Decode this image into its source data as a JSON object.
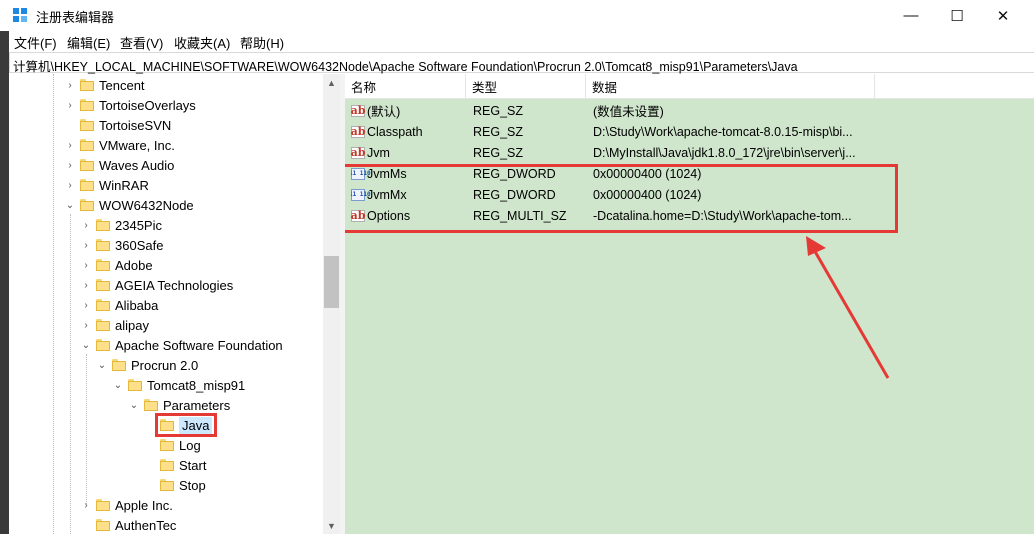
{
  "window": {
    "title": "注册表编辑器",
    "minimize": "—",
    "maximize": "☐",
    "close": "✕"
  },
  "menu": [
    "文件(F)",
    "编辑(E)",
    "查看(V)",
    "收藏夹(A)",
    "帮助(H)"
  ],
  "address": "计算机\\HKEY_LOCAL_MACHINE\\SOFTWARE\\WOW6432Node\\Apache Software Foundation\\Procrun 2.0\\Tomcat8_misp91\\Parameters\\Java",
  "tree": [
    {
      "label": "Tencent",
      "expander": "›"
    },
    {
      "label": "TortoiseOverlays",
      "expander": "›"
    },
    {
      "label": "TortoiseSVN",
      "expander": ""
    },
    {
      "label": "VMware, Inc.",
      "expander": "›"
    },
    {
      "label": "Waves Audio",
      "expander": "›"
    },
    {
      "label": "WinRAR",
      "expander": "›"
    },
    {
      "label": "WOW6432Node",
      "expander": "⌄"
    },
    {
      "label": "2345Pic",
      "expander": "›"
    },
    {
      "label": "360Safe",
      "expander": "›"
    },
    {
      "label": "Adobe",
      "expander": "›"
    },
    {
      "label": "AGEIA Technologies",
      "expander": "›"
    },
    {
      "label": "Alibaba",
      "expander": "›"
    },
    {
      "label": "alipay",
      "expander": "›"
    },
    {
      "label": "Apache Software Foundation",
      "expander": "⌄"
    },
    {
      "label": "Procrun 2.0",
      "expander": "⌄"
    },
    {
      "label": "Tomcat8_misp91",
      "expander": "⌄"
    },
    {
      "label": "Parameters",
      "expander": "⌄"
    },
    {
      "label": "Java",
      "expander": ""
    },
    {
      "label": "Log",
      "expander": ""
    },
    {
      "label": "Start",
      "expander": ""
    },
    {
      "label": "Stop",
      "expander": ""
    },
    {
      "label": "Apple Inc.",
      "expander": "›"
    },
    {
      "label": "AuthenTec",
      "expander": ""
    }
  ],
  "columns": [
    "名称",
    "类型",
    "数据"
  ],
  "values": [
    {
      "icon": "ab",
      "name": "(默认)",
      "type": "REG_SZ",
      "data": "(数值未设置)"
    },
    {
      "icon": "ab",
      "name": "Classpath",
      "type": "REG_SZ",
      "data": "D:\\Study\\Work\\apache-tomcat-8.0.15-misp\\bi..."
    },
    {
      "icon": "ab",
      "name": "Jvm",
      "type": "REG_SZ",
      "data": "D:\\MyInstall\\Java\\jdk1.8.0_172\\jre\\bin\\server\\j..."
    },
    {
      "icon": "bin",
      "name": "JvmMs",
      "type": "REG_DWORD",
      "data": "0x00000400 (1024)"
    },
    {
      "icon": "bin",
      "name": "JvmMx",
      "type": "REG_DWORD",
      "data": "0x00000400 (1024)"
    },
    {
      "icon": "ab",
      "name": "Options",
      "type": "REG_MULTI_SZ",
      "data": "-Dcatalina.home=D:\\Study\\Work\\apache-tom..."
    }
  ],
  "icons": {
    "ab_text": "ab",
    "bin_text": "011 110"
  },
  "colors": {
    "list_bg": "#cfe6cc",
    "highlight_red": "#e53935",
    "selection": "#cce8ff"
  }
}
